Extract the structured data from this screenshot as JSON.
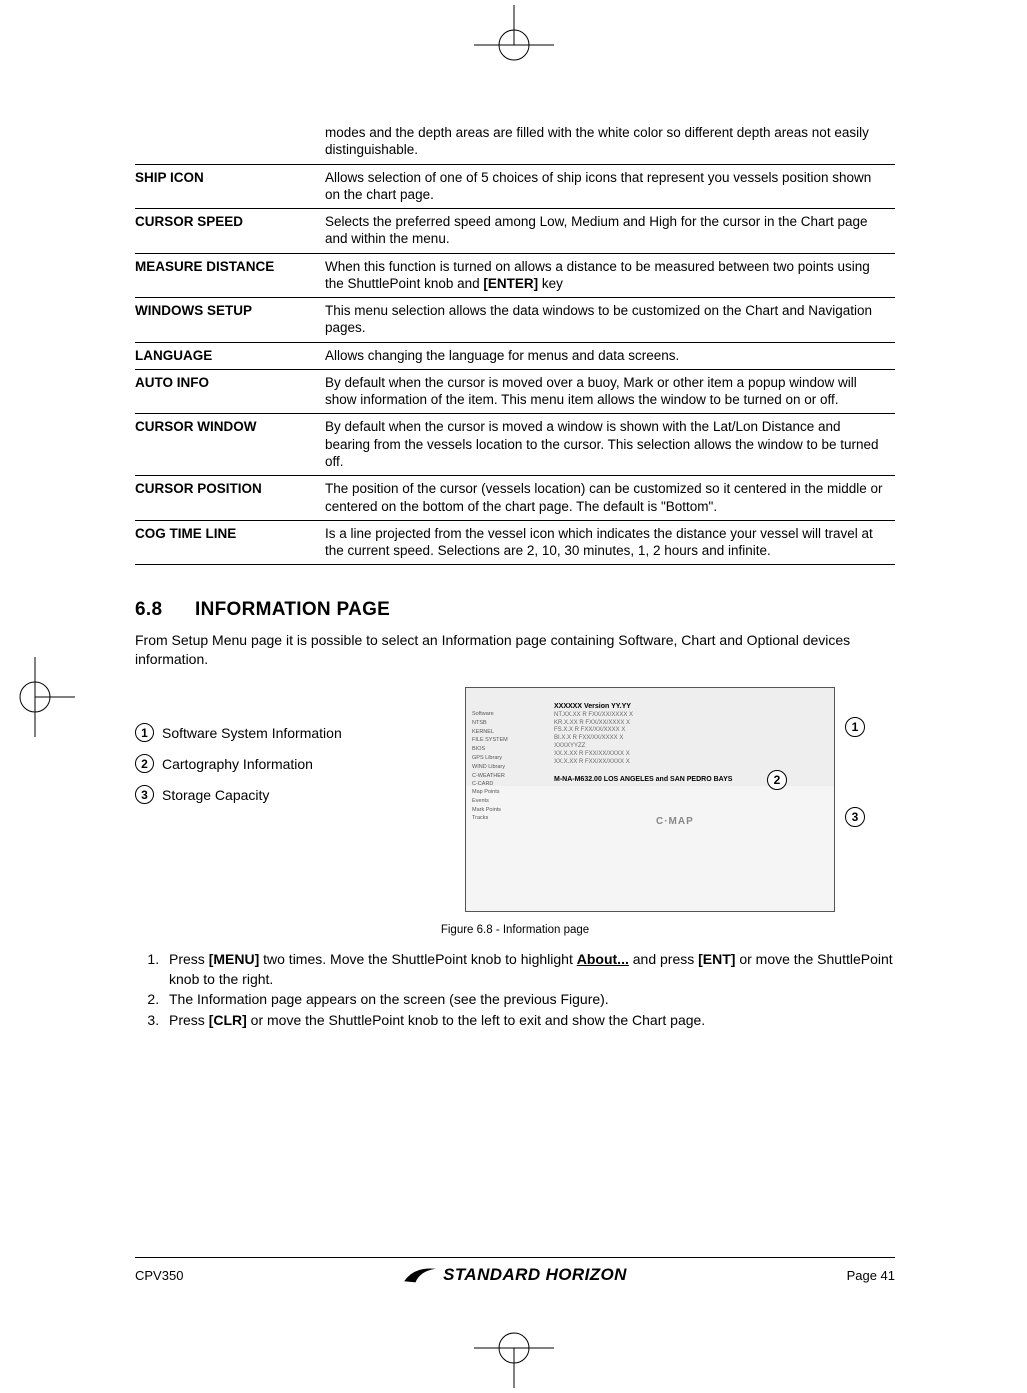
{
  "settings": [
    {
      "label": "",
      "desc": "modes and the depth areas are filled with the white color so different depth areas not easily distinguishable."
    },
    {
      "label": "SHIP ICON",
      "desc": "Allows selection of one of 5 choices of ship icons  that represent you vessels position shown on the chart page."
    },
    {
      "label": "CURSOR SPEED",
      "desc": "Selects the preferred speed among Low, Medium and High for the cursor in the Chart page and within the menu."
    },
    {
      "label": "MEASURE DISTANCE",
      "desc": "When this function is turned on allows a distance to be measured between two points using the ShuttlePoint knob and [ENTER] key",
      "boldTokens": [
        "[ENTER]"
      ]
    },
    {
      "label": "WINDOWS SETUP",
      "desc": "This menu selection allows the data windows to be customized on the Chart and Navigation pages."
    },
    {
      "label": "LANGUAGE",
      "desc": "Allows changing the language for menus and data screens."
    },
    {
      "label": "AUTO INFO",
      "desc": "By default when the cursor is moved over a buoy, Mark or other item a popup window will show information of the item. This menu item allows the window to be turned on or off."
    },
    {
      "label": "CURSOR WINDOW",
      "desc": "By default when the cursor is moved a window is shown with the Lat/Lon Distance and bearing from the vessels location to the cursor. This selection allows the window to be turned off."
    },
    {
      "label": "CURSOR POSITION",
      "desc": "The position of the cursor (vessels location) can be customized so it centered in the middle or centered on the bottom of the chart page. The default is \"Bottom\"."
    },
    {
      "label": "COG TIME LINE",
      "desc": "Is a line projected from the vessel icon which indicates the distance your vessel will travel at the current speed. Selections are 2, 10, 30 minutes, 1, 2 hours and infinite."
    }
  ],
  "section": {
    "num": "6.8",
    "title": "INFORMATION PAGE"
  },
  "intro": "From Setup Menu page it is possible to select an Information page containing Software, Chart and Optional devices information.",
  "legend": {
    "1": "Software System Information",
    "2": "Cartography Information",
    "3": "Storage Capacity"
  },
  "figure": {
    "version_label": "XXXXXX    Version YY.YY",
    "chart_line": "M-NA-M632.00   LOS ANGELES and SAN PEDRO BAYS",
    "cmap": "C·MAP",
    "caption": "Figure 6.8 - Information page"
  },
  "steps": [
    {
      "pre": "Press ",
      "b1": "[MENU]",
      "mid": " two times. Move the ShuttlePoint knob to highlight ",
      "u": "About...",
      "post": " and press ",
      "b2": "[ENT]",
      "tail": " or move the ShuttlePoint knob to the right."
    },
    {
      "text": "The Information page appears on the screen (see the previous Figure)."
    },
    {
      "pre": "Press ",
      "b1": "[CLR]",
      "tail": " or move the ShuttlePoint knob to the left to exit and show the Chart page."
    }
  ],
  "footer": {
    "model": "CPV350",
    "brand": "STANDARD HORIZON",
    "page": "Page 41"
  }
}
